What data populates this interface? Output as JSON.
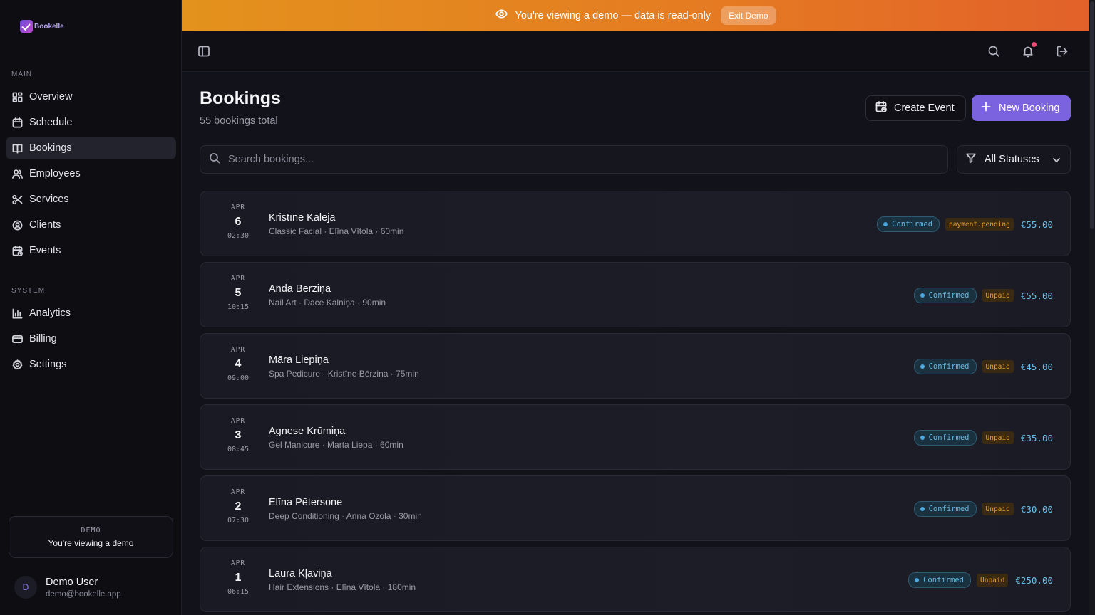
{
  "app": {
    "logo_text": "Bookelle"
  },
  "banner": {
    "text": "You're viewing a demo — data is read-only",
    "exit_label": "Exit Demo",
    "icon": "eye-icon"
  },
  "sidebar": {
    "main_label": "MAIN",
    "system_label": "SYSTEM",
    "main_items": [
      {
        "label": "Overview",
        "icon": "grid-icon",
        "active": false
      },
      {
        "label": "Schedule",
        "icon": "calendar-icon",
        "active": false
      },
      {
        "label": "Bookings",
        "icon": "book-icon",
        "active": true
      },
      {
        "label": "Employees",
        "icon": "users-icon",
        "active": false
      },
      {
        "label": "Services",
        "icon": "scissors-icon",
        "active": false
      },
      {
        "label": "Clients",
        "icon": "user-circle-icon",
        "active": false
      },
      {
        "label": "Events",
        "icon": "calendar-clock-icon",
        "active": false
      }
    ],
    "system_items": [
      {
        "label": "Analytics",
        "icon": "bar-chart-icon"
      },
      {
        "label": "Billing",
        "icon": "credit-card-icon"
      },
      {
        "label": "Settings",
        "icon": "gear-icon"
      }
    ],
    "demo_box": {
      "title": "DEMO",
      "text": "You're viewing a demo"
    },
    "user": {
      "initial": "D",
      "name": "Demo User",
      "email": "demo@bookelle.app"
    }
  },
  "topbar": {
    "icons": [
      "sidebar-toggle-icon",
      "search-icon",
      "bell-icon",
      "logout-icon"
    ]
  },
  "page": {
    "title": "Bookings",
    "subtitle": "55 bookings total",
    "create_event_label": "Create Event",
    "new_booking_label": "New Booking",
    "search_placeholder": "Search bookings...",
    "status_filter": "All Statuses"
  },
  "bookings": [
    {
      "month": "APR",
      "day": "6",
      "time": "02:30",
      "client": "Kristīne Kalēja",
      "meta": "Classic Facial · Elīna Vītola · 60min",
      "status": "Confirmed",
      "payment": "payment.pending",
      "price": "€55.00"
    },
    {
      "month": "APR",
      "day": "5",
      "time": "10:15",
      "client": "Anda Bērziņa",
      "meta": "Nail Art · Dace Kalniņa · 90min",
      "status": "Confirmed",
      "payment": "Unpaid",
      "price": "€55.00"
    },
    {
      "month": "APR",
      "day": "4",
      "time": "09:00",
      "client": "Māra Liepiņa",
      "meta": "Spa Pedicure · Kristīne Bērziņa · 75min",
      "status": "Confirmed",
      "payment": "Unpaid",
      "price": "€45.00"
    },
    {
      "month": "APR",
      "day": "3",
      "time": "08:45",
      "client": "Agnese Krūmiņa",
      "meta": "Gel Manicure · Marta Liepa · 60min",
      "status": "Confirmed",
      "payment": "Unpaid",
      "price": "€35.00"
    },
    {
      "month": "APR",
      "day": "2",
      "time": "07:30",
      "client": "Elīna Pētersone",
      "meta": "Deep Conditioning · Anna Ozola · 30min",
      "status": "Confirmed",
      "payment": "Unpaid",
      "price": "€30.00"
    },
    {
      "month": "APR",
      "day": "1",
      "time": "06:15",
      "client": "Laura Kļaviņa",
      "meta": "Hair Extensions · Elīna Vītola · 180min",
      "status": "Confirmed",
      "payment": "Unpaid",
      "price": "€250.00"
    }
  ],
  "colors": {
    "banner_start": "#e3921d",
    "banner_end": "#e2612a",
    "primary": "#7b63e0",
    "status_confirmed": "#66b6e0",
    "payment_badge": "#e5a12e"
  }
}
